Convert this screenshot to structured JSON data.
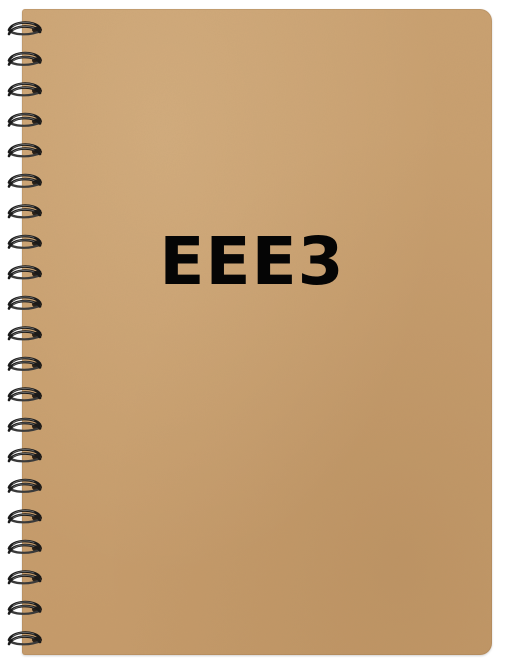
{
  "notebook": {
    "title": "EEE3",
    "cover_color": "#c99f6f",
    "title_color": "#050505",
    "binding": "spiral-wire",
    "wire_color": "#1a1a1a"
  }
}
